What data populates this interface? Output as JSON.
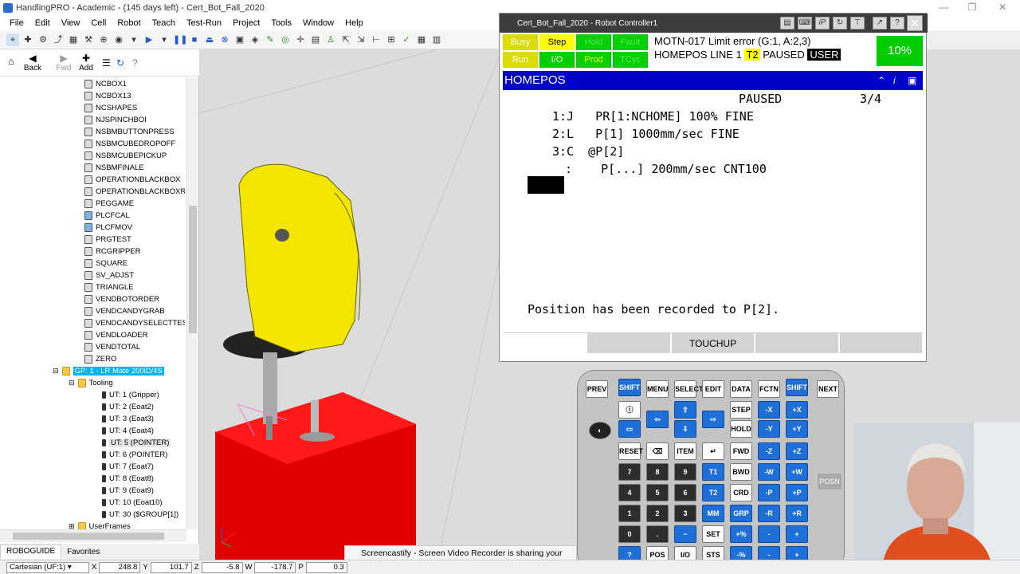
{
  "app": {
    "title": "HandlingPRO - Academic - (145 days left) - Cert_Bot_Fall_2020",
    "menu": [
      "File",
      "Edit",
      "View",
      "Cell",
      "Robot",
      "Teach",
      "Test-Run",
      "Project",
      "Tools",
      "Window",
      "Help"
    ]
  },
  "nav": {
    "back": "Back",
    "fwd": "Fwd",
    "add": "Add"
  },
  "tree": {
    "programs": [
      "NCBOX1",
      "NCBOX13",
      "NCSHAPES",
      "NJSPINCHBOI",
      "NSBMBUTTONPRESS",
      "NSBMCUBEDROPOFF",
      "NSBMCUBEPICKUP",
      "NSBMFINALE",
      "OPERATIONBLACKBOX",
      "OPERATIONBLACKBOXRVS",
      "PEGGAME",
      "PLCFCAL",
      "PLCFMOV",
      "PRGTEST",
      "RCGRIPPER",
      "SQUARE",
      "SV_ADJST",
      "TRIANGLE",
      "VENDBOTORDER",
      "VENDCANDYGRAB",
      "VENDCANDYSELECTTEST",
      "VENDLOADER",
      "VENDTOTAL",
      "ZERO"
    ],
    "group": "GP: 1 - LR Mate 200iD/4S",
    "tooling": "Tooling",
    "tools": [
      "UT: 1 (Gripper)",
      "UT: 2 (Eoat2)",
      "UT: 3 (Eoat3)",
      "UT: 4 (Eoat4)",
      "UT: 5 (POINTER)",
      "UT: 6 (POINTER)",
      "UT: 7 (Eoat7)",
      "UT: 8 (Eoat8)",
      "UT: 9 (Eoat9)",
      "UT: 10 (Eoat10)",
      "UT: 30 ($GROUP[1])"
    ],
    "userframes": "UserFrames"
  },
  "tabs": {
    "robo": "ROBOGUIDE",
    "fav": "Favorites"
  },
  "status": {
    "frame": "Cartesian (UF:1)",
    "x_label": "X",
    "x": "248.8",
    "y_label": "Y",
    "y": "101.7",
    "z_label": "Z",
    "z": "-5.8",
    "w_label": "W",
    "w": "-178.7",
    "p_label": "P",
    "p": "0.3"
  },
  "toast": "Screencastify - Screen Video Recorder is sharing your screen.",
  "pendant": {
    "title": "Cert_Bot_Fall_2020 - Robot Controller1",
    "lamps": {
      "busy": "Busy",
      "step": "Step",
      "hold": "Hold",
      "fault": "Fault",
      "run": "Run",
      "io": "I/O",
      "prod": "Prod",
      "tcyc": "TCyc"
    },
    "status_line1": "MOTN-017 Limit error (G:1, A:2,3)",
    "status_line2_a": "HOMEPOS LINE 1",
    "status_line2_t2": "T2",
    "status_line2_b": "PAUSED",
    "status_line2_user": "USER",
    "override": "10%",
    "program": "HOMEPOS",
    "state": "PAUSED",
    "line_pos": "3/4",
    "lines": [
      "1:J   PR[1:NCHOME] 100% FINE",
      "2:L   P[1] 1000mm/sec FINE",
      "3:C  @P[2]",
      ":    P[...] 200mm/sec CNT100",
      "[End]"
    ],
    "message": "Position has been recorded to P[2].",
    "fkeys": [
      "",
      "",
      "TOUCHUP",
      "",
      ""
    ]
  },
  "keypad": {
    "row1": [
      "PREV",
      "SHIFT",
      "MENU",
      "SELECT",
      "EDIT",
      "DATA",
      "FCTN",
      "SHIFT",
      "NEXT"
    ],
    "nums": [
      "7",
      "8",
      "9",
      "4",
      "5",
      "6",
      "1",
      "2",
      "3",
      "0",
      "."
    ],
    "posn": "POSN"
  }
}
